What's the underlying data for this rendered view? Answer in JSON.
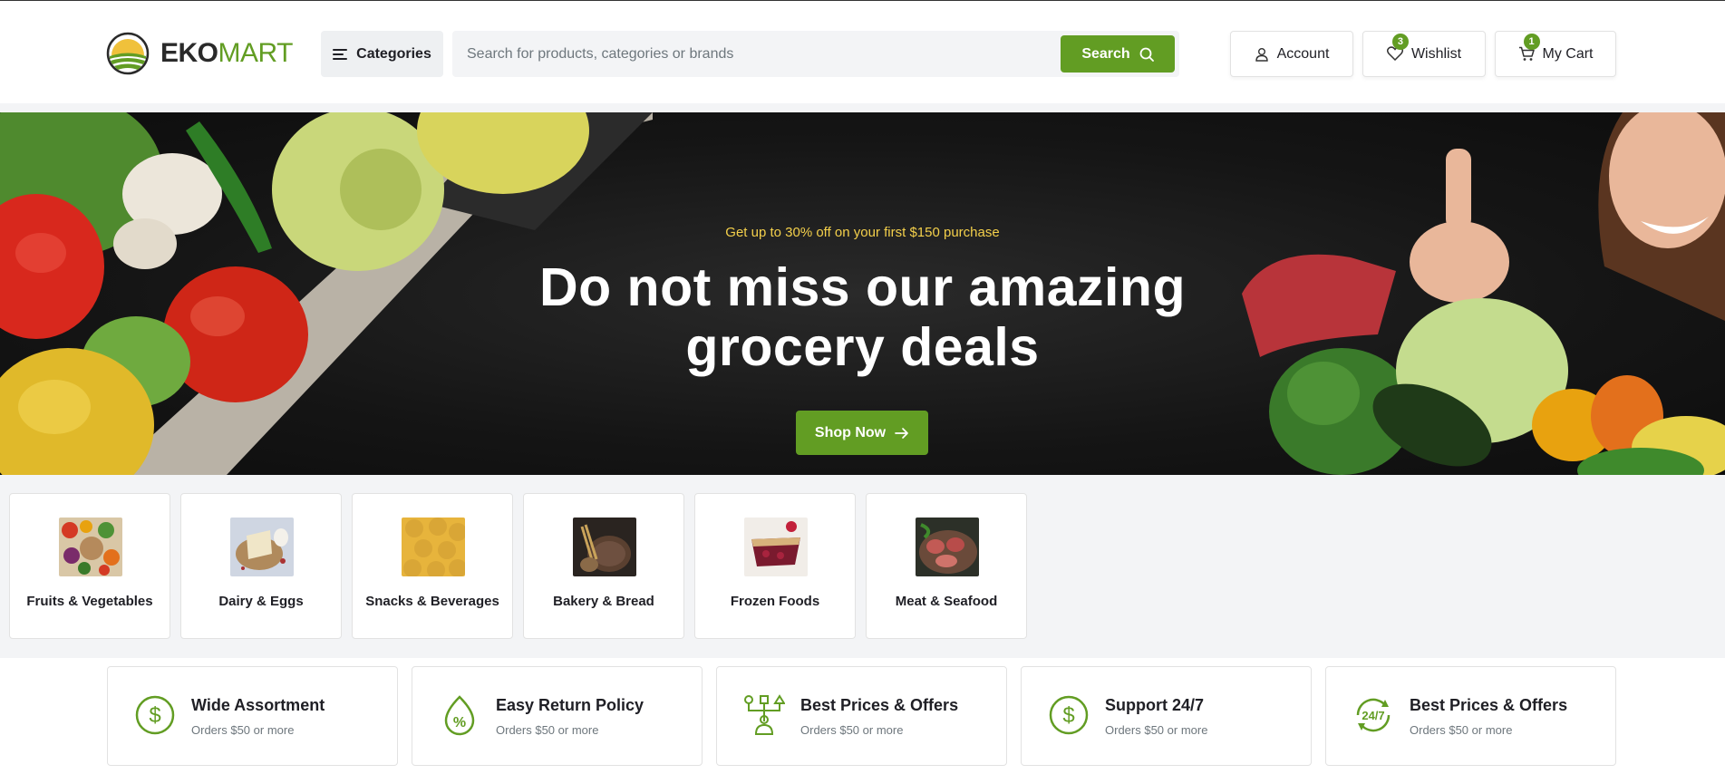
{
  "header": {
    "logo_text_bold": "EKO",
    "logo_text_light": "MART",
    "categories_label": "Categories",
    "search_placeholder": "Search for products, categories or brands",
    "search_button": "Search",
    "account_label": "Account",
    "wishlist_label": "Wishlist",
    "wishlist_count": "3",
    "cart_label": "My Cart",
    "cart_count": "1"
  },
  "banner": {
    "subtitle": "Get up to 30% off on your first $150 purchase",
    "title_line1": "Do not miss our amazing",
    "title_line2": "grocery deals",
    "cta": "Shop Now"
  },
  "categories": [
    {
      "label": "Fruits & Vegetables"
    },
    {
      "label": "Dairy & Eggs"
    },
    {
      "label": "Snacks & Beverages"
    },
    {
      "label": "Bakery & Bread"
    },
    {
      "label": "Frozen Foods"
    },
    {
      "label": "Meat & Seafood"
    }
  ],
  "features": [
    {
      "title": "Wide Assortment",
      "subtitle": "Orders $50 or more",
      "icon": "dollar-circle-icon"
    },
    {
      "title": "Easy Return Policy",
      "subtitle": "Orders $50 or more",
      "icon": "percent-drop-icon"
    },
    {
      "title": "Best Prices & Offers",
      "subtitle": "Orders $50 or more",
      "icon": "network-person-icon"
    },
    {
      "title": "Support 24/7",
      "subtitle": "Orders $50 or more",
      "icon": "dollar-circle-icon"
    },
    {
      "title": "Best Prices & Offers",
      "subtitle": "Orders $50 or more",
      "icon": "support-247-icon"
    }
  ],
  "colors": {
    "brand_green": "#629d23",
    "promo_yellow": "#f4d04b",
    "text_dark": "#1f1f25"
  }
}
